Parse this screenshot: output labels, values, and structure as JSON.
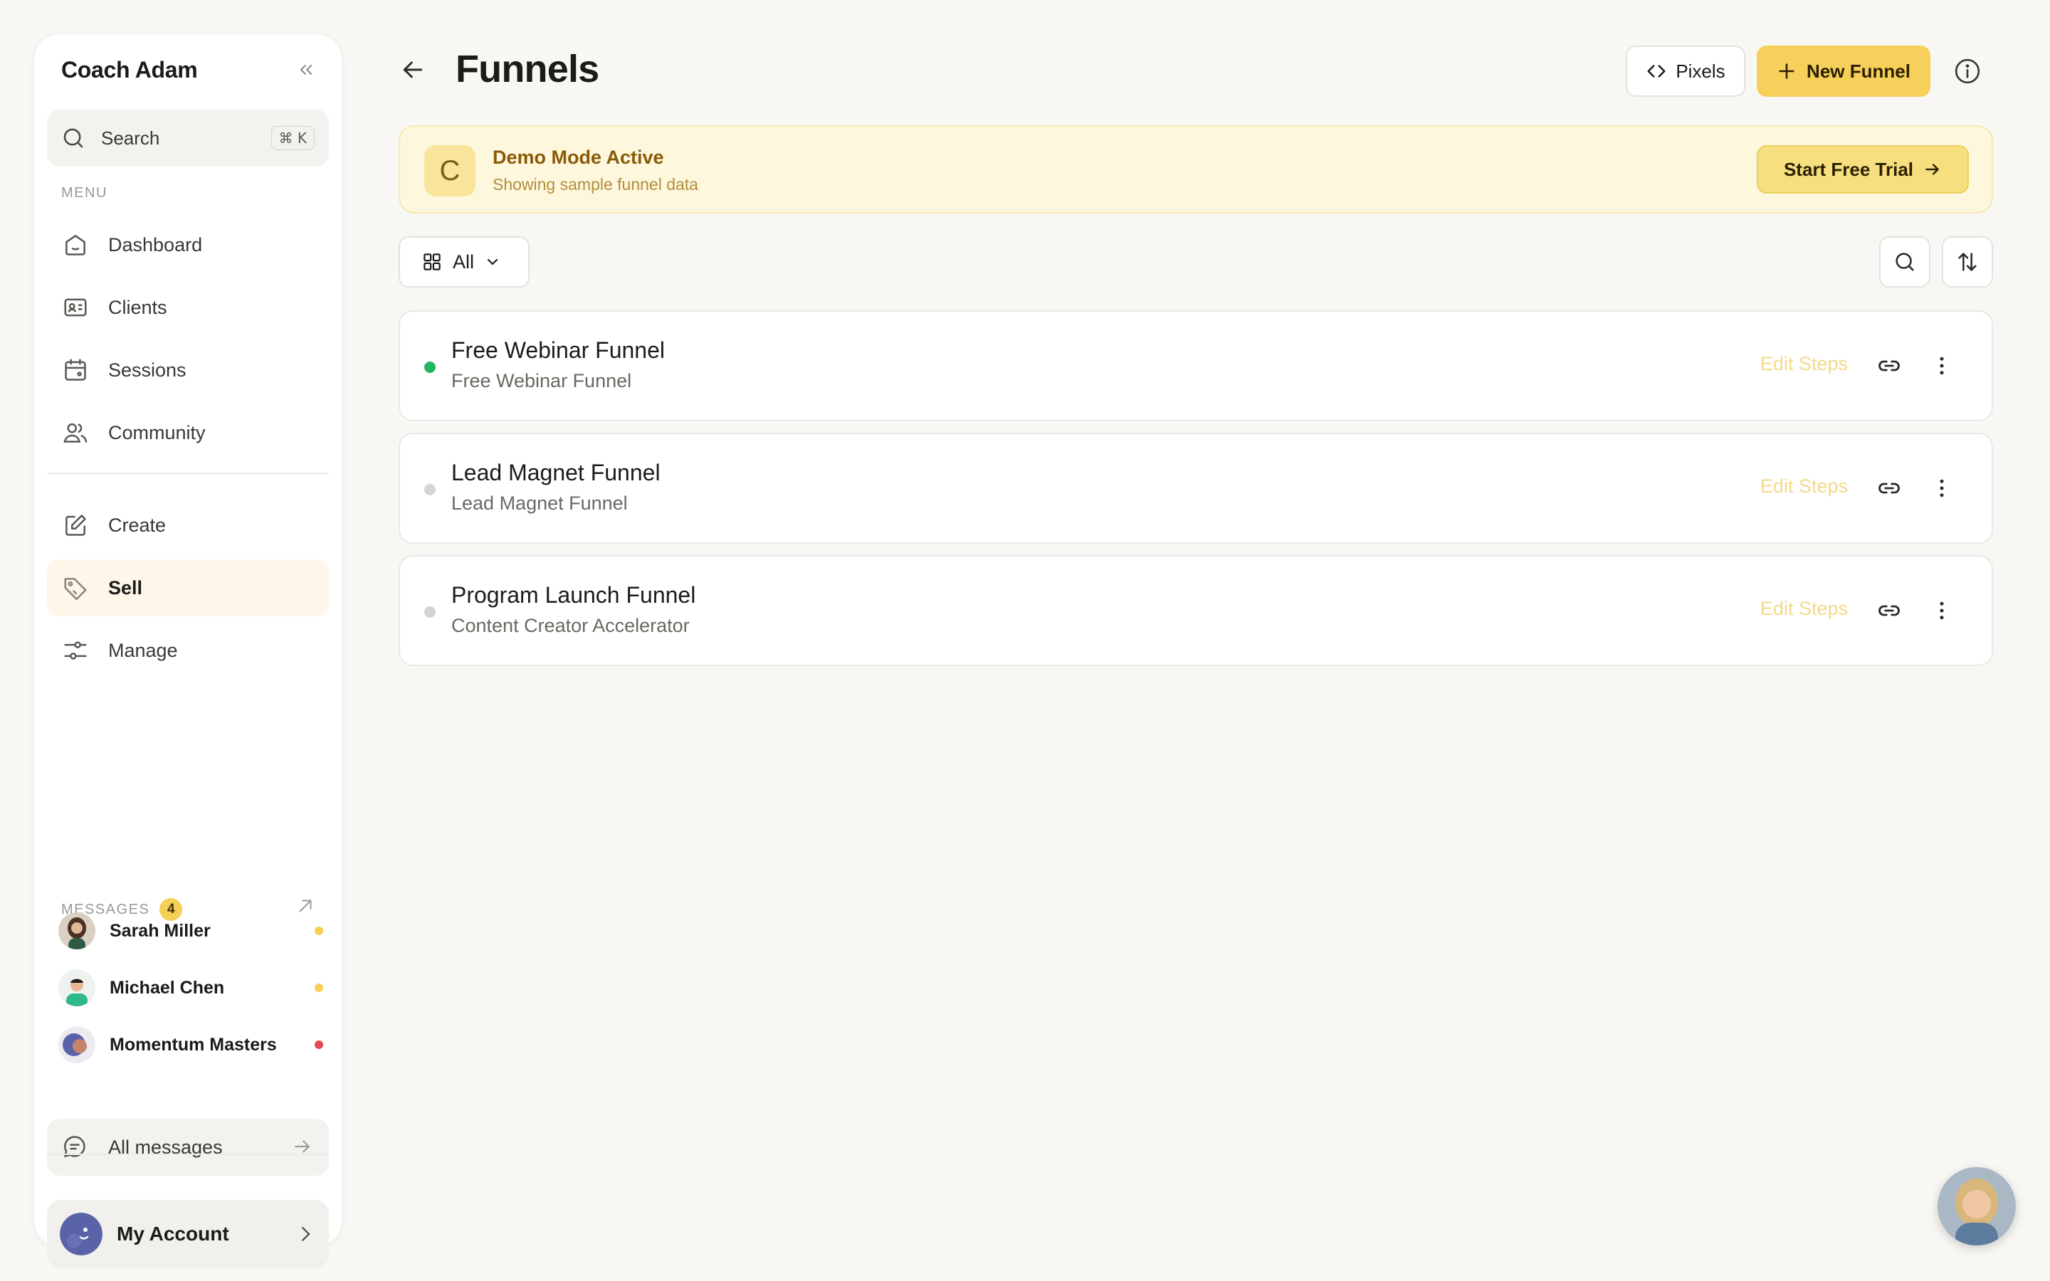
{
  "sidebar": {
    "brand": "Coach Adam",
    "search": {
      "label": "Search",
      "shortcut": "⌘ K"
    },
    "menu_label": "MENU",
    "items": [
      {
        "label": "Dashboard",
        "icon": "home-icon"
      },
      {
        "label": "Clients",
        "icon": "contact-card-icon"
      },
      {
        "label": "Sessions",
        "icon": "calendar-icon"
      },
      {
        "label": "Community",
        "icon": "users-icon"
      },
      {
        "label": "Create",
        "icon": "edit-icon"
      },
      {
        "label": "Sell",
        "icon": "tag-icon",
        "active": true
      },
      {
        "label": "Manage",
        "icon": "sliders-icon"
      }
    ],
    "messages": {
      "label": "MESSAGES",
      "count": "4",
      "items": [
        {
          "name": "Sarah Miller",
          "dot_color": "#f6cf56"
        },
        {
          "name": "Michael Chen",
          "dot_color": "#f6cf56"
        },
        {
          "name": "Momentum Masters",
          "dot_color": "#e5484d"
        }
      ],
      "all_label": "All messages"
    },
    "account": {
      "label": "My Account"
    }
  },
  "header": {
    "title": "Funnels",
    "pixels_label": "Pixels",
    "new_funnel_label": "New Funnel"
  },
  "demo": {
    "logo_letter": "C",
    "title": "Demo Mode Active",
    "subtitle": "Showing sample funnel data",
    "cta": "Start Free Trial"
  },
  "filter": {
    "label": "All"
  },
  "funnels": [
    {
      "title": "Free Webinar Funnel",
      "subtitle": "Free Webinar Funnel",
      "status_color": "#22b55e",
      "edit_label": "Edit Steps"
    },
    {
      "title": "Lead Magnet Funnel",
      "subtitle": "Lead Magnet Funnel",
      "status_color": "#d6d4d0",
      "edit_label": "Edit Steps"
    },
    {
      "title": "Program Launch Funnel",
      "subtitle": "Content Creator Accelerator",
      "status_color": "#d6d4d0",
      "edit_label": "Edit Steps"
    }
  ],
  "colors": {
    "accent": "#f7cf5b",
    "background": "#f8f7f4",
    "active_nav": "#fdf6e9"
  }
}
